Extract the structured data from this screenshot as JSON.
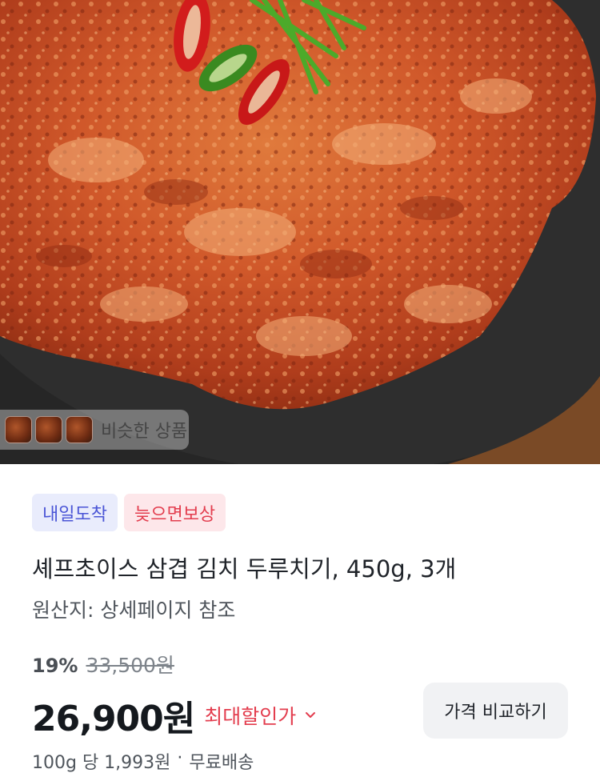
{
  "product_image": {
    "similar_products_label": "비슷한 상품"
  },
  "badges": [
    "내일도착",
    "늦으면보상"
  ],
  "product": {
    "title": "셰프초이스 삼겹 김치 두루치기, 450g, 3개",
    "origin": "원산지: 상세페이지 참조"
  },
  "pricing": {
    "discount_rate": "19%",
    "original_price": "33,500원",
    "sale_price": "26,900원",
    "price_tag": "최대할인가",
    "compare_button": "가격 비교하기",
    "unit_price": "100g 당 1,993원",
    "separator": "·",
    "shipping": "무료배송"
  },
  "colors": {
    "accent_red": "#e33d4e",
    "accent_blue": "#4a55d6"
  }
}
